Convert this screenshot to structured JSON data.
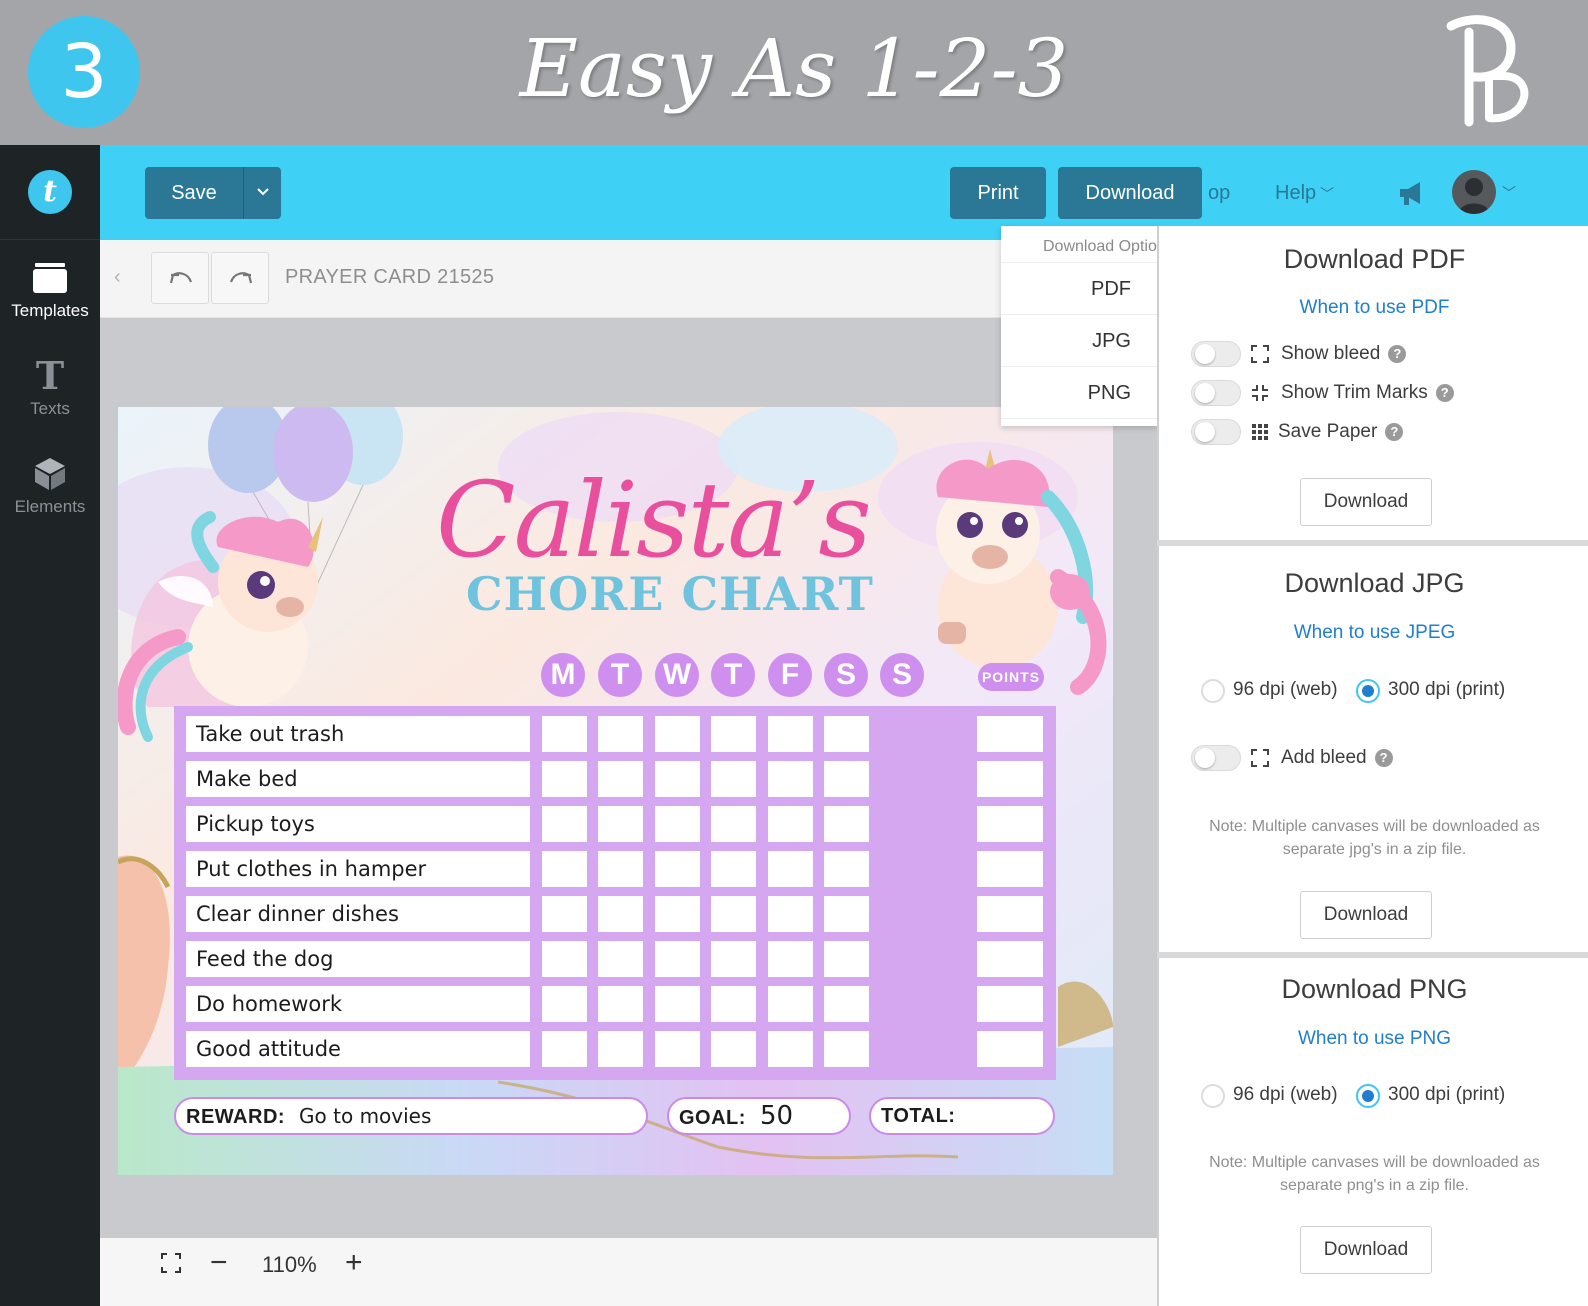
{
  "banner": {
    "step_number": "3",
    "title": "Easy As 1-2-3",
    "logo_text": "PD"
  },
  "sidebar": {
    "brand_letter": "t",
    "items": [
      {
        "label": "Templates",
        "icon": "templates-icon",
        "active": true
      },
      {
        "label": "Texts",
        "icon": "text-icon",
        "active": false
      },
      {
        "label": "Elements",
        "icon": "elements-icon",
        "active": false
      }
    ]
  },
  "toolbar": {
    "save_label": "Save",
    "print_label": "Print",
    "download_label": "Download",
    "truncated_label": "op",
    "help_label": "Help",
    "icons": [
      "chevron-down-icon",
      "megaphone-icon",
      "avatar"
    ]
  },
  "subbar": {
    "document_title": "PRAYER CARD 21525",
    "icons": [
      "back-arrow-icon",
      "undo-icon",
      "redo-icon"
    ]
  },
  "bottombar": {
    "zoom": "110%",
    "zoom_out": "−",
    "zoom_in": "+"
  },
  "chart": {
    "title": "Calista’s",
    "subtitle": "CHORE CHART",
    "days": [
      "M",
      "T",
      "W",
      "T",
      "F",
      "S",
      "S"
    ],
    "points_label": "POINTS",
    "chores": [
      "Take out trash",
      "Make bed",
      "Pickup toys",
      "Put clothes in hamper",
      "Clear dinner dishes",
      "Feed the dog",
      "Do homework",
      "Good attitude"
    ],
    "reward_label": "REWARD:",
    "reward_value": "Go to movies",
    "goal_label": "GOAL:",
    "goal_value": "50",
    "total_label": "TOTAL:"
  },
  "download_menu": {
    "header": "Download Options",
    "items": [
      "PDF",
      "JPG",
      "PNG"
    ]
  },
  "pdf_panel": {
    "title": "Download PDF",
    "link": "When to use PDF",
    "options": [
      "Show bleed",
      "Show Trim Marks",
      "Save Paper"
    ],
    "button": "Download"
  },
  "jpg_panel": {
    "title": "Download JPG",
    "link": "When to use JPEG",
    "dpi_options": [
      "96 dpi (web)",
      "300 dpi (print)"
    ],
    "selected_dpi": "300 dpi (print)",
    "bleed_option": "Add bleed",
    "note": "Note: Multiple canvases will be downloaded as separate jpg's in a zip file.",
    "button": "Download"
  },
  "png_panel": {
    "title": "Download PNG",
    "link": "When to use PNG",
    "dpi_options": [
      "96 dpi (web)",
      "300 dpi (print)"
    ],
    "selected_dpi": "300 dpi (print)",
    "note": "Note: Multiple canvases will be downloaded as separate png's in a zip file.",
    "button": "Download"
  },
  "colors": {
    "accent": "#3ed1f5",
    "button_dark": "#2a7896",
    "sidebar": "#1e2326",
    "link": "#1f7ed0",
    "chart_purple": "#d4a7f0",
    "chart_pink": "#e8509e",
    "chart_teal": "#6fc3dd"
  }
}
